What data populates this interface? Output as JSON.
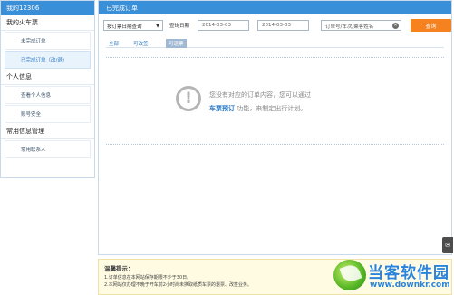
{
  "sidebar": {
    "title": "我的12306",
    "sections": [
      {
        "label": "我的火车票",
        "items": [
          {
            "label": "未完成订单"
          },
          {
            "label": "已完成订单（改/退）"
          }
        ]
      },
      {
        "label": "个人信息",
        "items": [
          {
            "label": "查看个人信息"
          },
          {
            "label": "账号安全"
          }
        ]
      },
      {
        "label": "常用信息管理",
        "items": [
          {
            "label": "常用联系人"
          }
        ]
      }
    ]
  },
  "main": {
    "title": "已完成订单",
    "search": {
      "query_type": "按订票日期查询",
      "date_label": "查询日期",
      "date_from": "2014-03-03",
      "date_sep": "-",
      "date_to": "2014-03-03",
      "keyword_placeholder": "订单号/车次/乘客姓名",
      "button": "查询"
    },
    "tabs": [
      "全部",
      "可改签",
      "可退票"
    ],
    "empty": {
      "line1": "您没有对应的订单内容，您可以通过",
      "link": "车票预订",
      "line2_suffix": "功能，来制定出行计划。"
    }
  },
  "tips": {
    "title": "温馨提示：",
    "lines": [
      "1.订单信息在本网站保存期限不少于30日。",
      "2.本网站仅办理不晚于开车前2小时尚未换取纸质车票的退票、改签业务。"
    ]
  },
  "watermark": {
    "title": "当客软件园",
    "url": "www.downkr.com"
  },
  "icons": {
    "warn": "warning-circle-icon",
    "clear": "clear-icon",
    "dropdown": "chevron-down-icon"
  },
  "colors": {
    "header": "#3a8fd9",
    "search_button": "#f5821f",
    "link": "#2a78c4",
    "tip_bg": "#fffbe3"
  }
}
